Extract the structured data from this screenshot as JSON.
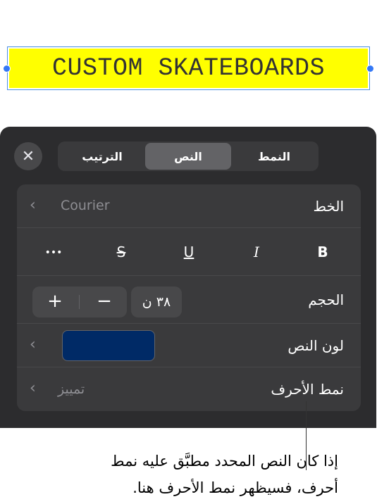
{
  "canvas": {
    "text": "CUSTOM SKATEBOARDS",
    "highlight_color": "#ffff00"
  },
  "panel": {
    "close_icon": "x-icon",
    "tabs": [
      {
        "label": "النمط",
        "active": false
      },
      {
        "label": "النص",
        "active": true
      },
      {
        "label": "الترتيب",
        "active": false
      }
    ],
    "font_row": {
      "label": "الخط",
      "value": "Courier"
    },
    "style_buttons": {
      "bold": "B",
      "italic": "I",
      "underline": "U",
      "strikethrough": "S",
      "more": "•••"
    },
    "size_row": {
      "label": "الحجم",
      "value": "٣٨ ن",
      "plus": "+",
      "minus": "−"
    },
    "color_row": {
      "label": "لون النص",
      "swatch_color": "#002a66"
    },
    "char_style_row": {
      "label": "نمط الأحرف",
      "value": "تمييز"
    }
  },
  "caption": {
    "line1": "إذا كان النص المحدد مطبَّق عليه نمط",
    "line2": "أحرف، فسيظهر نمط الأحرف هنا."
  }
}
